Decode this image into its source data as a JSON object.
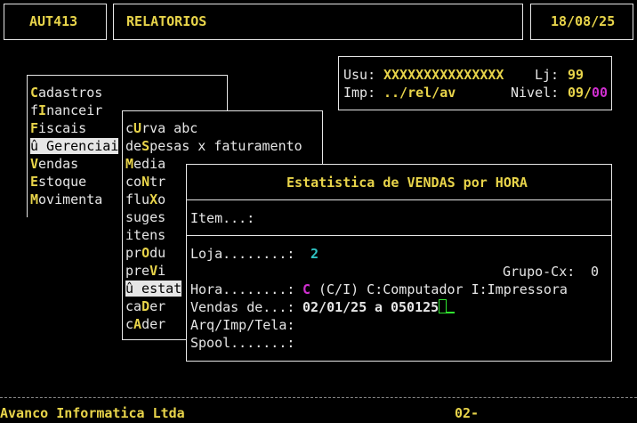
{
  "header": {
    "code": "AUT413",
    "module": "RELATORIOS",
    "date": "18/08/25"
  },
  "user_panel": {
    "usu_label": "Usu:",
    "usu_value": "XXXXXXXXXXXXXXX",
    "lj_label": "Lj:",
    "lj_value": "99",
    "imp_label": "Imp:",
    "imp_value": "../rel/av",
    "nivel_label": "Nivel:",
    "nivel_value": "09/",
    "nivel_value2": "00"
  },
  "main_menu": {
    "items": [
      {
        "pre": "",
        "hot": "C",
        "post": "adastros"
      },
      {
        "pre": "f",
        "hot": "I",
        "post": "nanceir"
      },
      {
        "pre": "",
        "hot": "F",
        "post": "iscais"
      },
      {
        "pre": "û Gerenciai",
        "hot": "",
        "post": ""
      },
      {
        "pre": "",
        "hot": "V",
        "post": "endas"
      },
      {
        "pre": "",
        "hot": "E",
        "post": "stoque"
      },
      {
        "pre": "",
        "hot": "M",
        "post": "ovimenta"
      }
    ]
  },
  "sub_menu": {
    "items": [
      {
        "pre": "c",
        "hot": "U",
        "post": "rva abc"
      },
      {
        "pre": "de",
        "hot": "S",
        "post": "pesas x faturamento"
      },
      {
        "pre": "",
        "hot": "M",
        "post": "edia"
      },
      {
        "pre": "co",
        "hot": "N",
        "post": "tr"
      },
      {
        "pre": "flu",
        "hot": "X",
        "post": "o"
      },
      {
        "pre": "suges",
        "hot": "",
        "post": ""
      },
      {
        "pre": "itens",
        "hot": "",
        "post": ""
      },
      {
        "pre": "pr",
        "hot": "O",
        "post": "du"
      },
      {
        "pre": "pre",
        "hot": "V",
        "post": "i"
      },
      {
        "pre": "û estat",
        "hot": "",
        "post": ""
      },
      {
        "pre": "ca",
        "hot": "D",
        "post": "er"
      },
      {
        "pre": "c",
        "hot": "A",
        "post": "der"
      }
    ]
  },
  "dialog": {
    "title": "Estatistica de VENDAS por HORA",
    "item_label": "Item...:",
    "loja_label": "Loja........:",
    "loja_value": "2",
    "grupo_label": "Grupo-Cx:",
    "grupo_value": "0",
    "hora_label": "Hora........:",
    "hora_value": "C",
    "hora_help": "(C/I) C:Computador I:Impressora",
    "vendas_label": "Vendas de...:",
    "vendas_from": "02/01/25",
    "vendas_sep": "a",
    "vendas_to": "050125",
    "arq_label": "Arq/Imp/Tela:",
    "spool_label": "Spool.......:"
  },
  "footer": {
    "company": "Avanco Informatica Ltda",
    "page": "02-"
  }
}
